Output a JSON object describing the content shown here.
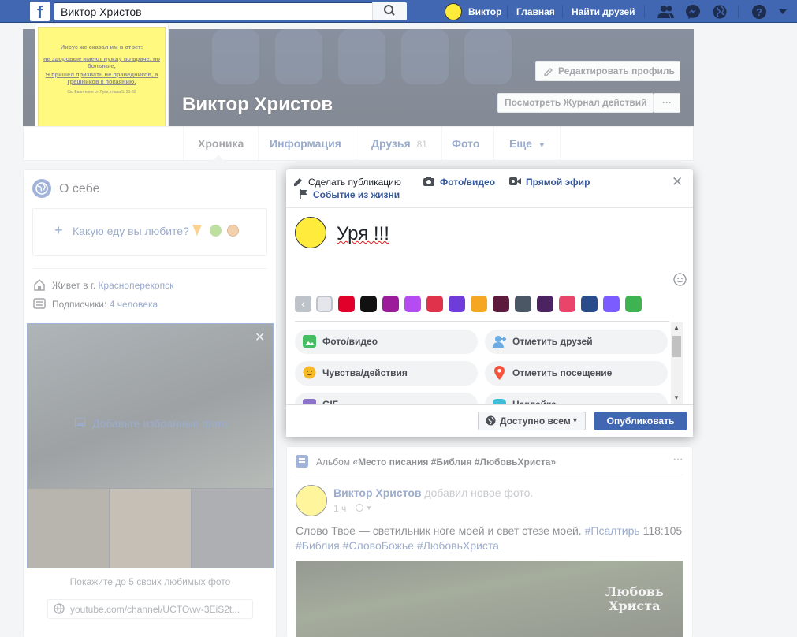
{
  "header": {
    "search_value": "Виктор Христов",
    "user_name": "Виктор",
    "nav_home": "Главная",
    "nav_find_friends": "Найти друзей"
  },
  "profile": {
    "name": "Виктор Христов",
    "edit_button": "Редактировать профиль",
    "activity_button": "Посмотреть Журнал действий",
    "more_button": "···",
    "picture_lines": [
      "Иисус же сказал им в ответ:",
      "не здоровые имеют нужду во враче, но больные;",
      "Я пришел призвать не праведников, а грешников к покаянию.",
      "Св. Евангелие от Луки, глава 5. 31-32"
    ]
  },
  "tabs": {
    "timeline": "Хроника",
    "info": "Информация",
    "friends": "Друзья",
    "friends_count": "81",
    "photos": "Фото",
    "more": "Еще"
  },
  "intro": {
    "title": "О себе",
    "food_prompt": "Какую еду вы любите?",
    "lives_in_label": "Живет в г.",
    "lives_in_city": "Красноперекопск",
    "followers_label": "Подписчики:",
    "followers_value": "4 человека",
    "featured_add": "Добавьте избранные фото",
    "featured_hint": "Покажите до 5 своих любимых фото",
    "youtube_link": "youtube.com/channel/UCTOwv-3EiS2t..."
  },
  "composer": {
    "tab_post": "Сделать публикацию",
    "tab_photo": "Фото/видео",
    "tab_live": "Прямой эфир",
    "tab_event": "Событие из жизни",
    "text": "Уря !!!",
    "options": [
      "Фото/видео",
      "Отметить друзей",
      "Чувства/действия",
      "Отметить посещение",
      "GIF",
      "Наклейка"
    ],
    "audience": "Доступно всем",
    "publish": "Опубликовать",
    "swatch_colors": [
      "#e4e6eb",
      "#e0002a",
      "#111111",
      "#9b1b9a",
      "#b44cf2",
      "#e0324b",
      "#6e3cd8",
      "#f5a623",
      "#5c1a3c",
      "#4c5766",
      "#4a2360",
      "#e9446a",
      "#2b4c8a",
      "#7a5cff",
      "#3fb34f"
    ]
  },
  "post": {
    "album_label": "Альбом",
    "album_name": "«Место писания #Библия #ЛюбовьХриста»",
    "author": "Виктор Христов",
    "action": "добавил новое фото.",
    "time": "1 ч",
    "text_main": "Слово Твое — светильник ноге моей и свет стезе моей.",
    "tag_psalm": "#Псалтирь",
    "ref": "118:105",
    "tag_bible": "#Библия",
    "tag_word": "#СловоБожье",
    "tag_love": "#ЛюбовьХриста",
    "image_caption_1": "Любовь",
    "image_caption_2": "Христа"
  }
}
